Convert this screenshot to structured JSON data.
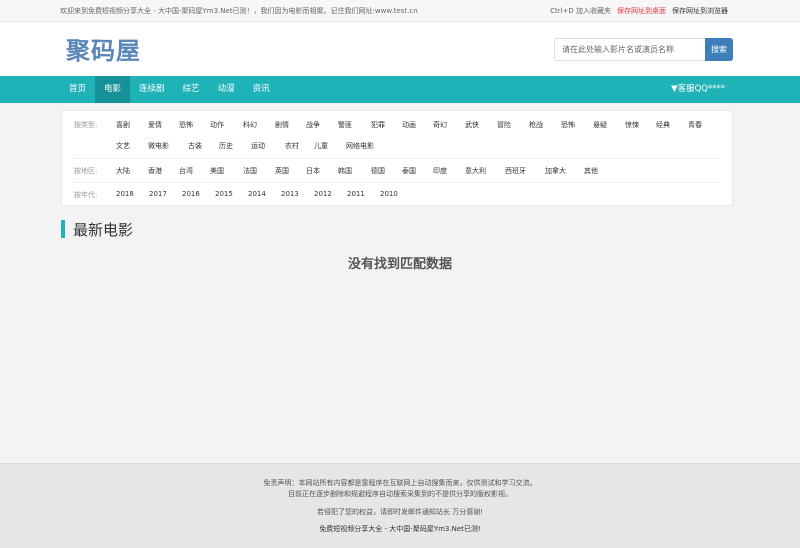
{
  "topbar": {
    "welcome": "欢迎来到免费短视频分享大全 - 大中国-聚码屋Ym3.Net已测！，我们因为电影而相聚。记住我们网址:www.test.cn",
    "bookmark": "Ctrl+D 加入收藏夹",
    "save_desktop": "保存网址到桌面",
    "save_browser": "保存网址到浏览器"
  },
  "header": {
    "logo": "聚码屋",
    "search_placeholder": "请在此处输入影片名或演员名称",
    "search_button": "搜索"
  },
  "nav": {
    "items": [
      "首页",
      "电影",
      "连续剧",
      "综艺",
      "动漫",
      "资讯"
    ],
    "active_index": 1,
    "service": "▼客服QQ****"
  },
  "filter": {
    "type_label": "按类型:",
    "types": [
      "喜剧",
      "爱情",
      "恐怖",
      "动作",
      "科幻",
      "剧情",
      "战争",
      "警匪",
      "犯罪",
      "动画",
      "奇幻",
      "武侠",
      "冒险",
      "枪战",
      "恐怖",
      "悬疑",
      "惊悚",
      "经典",
      "青春",
      "文艺",
      "微电影",
      "古装",
      "历史",
      "运动",
      "农村",
      "儿童",
      "网络电影"
    ],
    "region_label": "按地区:",
    "regions": [
      "大陆",
      "香港",
      "台湾",
      "美国",
      "法国",
      "英国",
      "日本",
      "韩国",
      "德国",
      "泰国",
      "印度",
      "意大利",
      "西班牙",
      "加拿大",
      "其他"
    ],
    "year_label": "按年代:",
    "years": [
      "2018",
      "2017",
      "2016",
      "2015",
      "2014",
      "2013",
      "2012",
      "2011",
      "2010"
    ]
  },
  "section": {
    "title": "最新电影",
    "empty_message": "没有找到匹配数据"
  },
  "footer": {
    "line1": "免责声明：本网站所有内容都是靠程序在互联网上自动搜集而来，仅供测试和学习交流。",
    "line2": "目前正在逐步删除和规避程序自动搜索采集到的不提供分享的版权影视。",
    "line3": "若侵犯了您的权益，请即时发邮件通知站长 万分感谢!",
    "line4": "免费短视频分享大全 - 大中国-聚码屋Ym3.Net已测!"
  },
  "colors": {
    "nav_bg": "#1fb3b8",
    "nav_active": "#179198",
    "search_button": "#3d7fb8",
    "logo": "#5a86b8",
    "link_red": "#e4393c"
  }
}
